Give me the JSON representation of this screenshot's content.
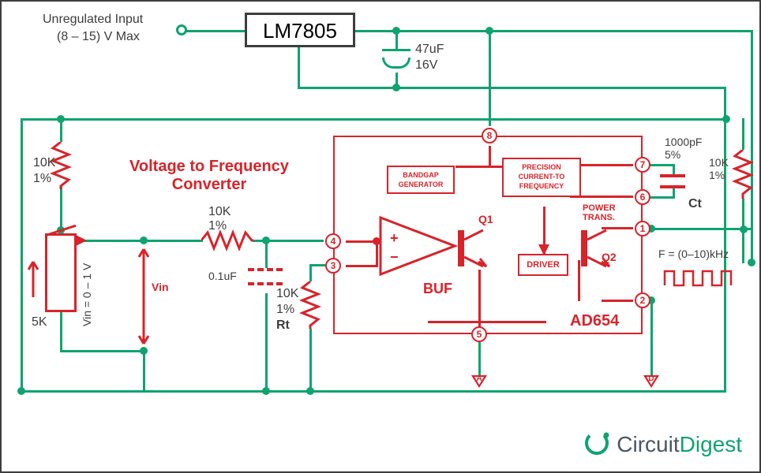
{
  "input": {
    "label_line1": "Unregulated Input",
    "label_line2": "(8 – 15) V Max"
  },
  "regulator": {
    "name": "LM7805"
  },
  "c1": {
    "value": "47uF",
    "voltage": "16V"
  },
  "c2": {
    "value": "0.1uF"
  },
  "ct": {
    "value": "1000pF",
    "tolerance": "5%",
    "name": "Ct"
  },
  "r_top_left": {
    "value": "10K",
    "tolerance": "1%"
  },
  "r_series": {
    "value": "10K",
    "tolerance": "1%"
  },
  "rt": {
    "value": "10K",
    "tolerance": "1%",
    "name": "Rt"
  },
  "r_pullup": {
    "value": "10K",
    "tolerance": "1%"
  },
  "pot": {
    "value": "5K",
    "range": "Vin = 0 – 1 V",
    "tap_label": "Vin"
  },
  "title": "Voltage to Frequency\nConverter",
  "ic": {
    "name": "AD654",
    "pins": {
      "p1": "1",
      "p2": "2",
      "p3": "3",
      "p4": "4",
      "p5": "5",
      "p6": "6",
      "p7": "7",
      "p8": "8"
    },
    "blocks": {
      "bandgap": "BANDGAP\nGENERATOR",
      "precision": "PRECISION\nCURRENT-TO\nFREQUENCY",
      "driver": "DRIVER",
      "power_trans": "POWER\nTRANS.",
      "buf": "BUF",
      "q1": "Q1",
      "q2": "Q2"
    }
  },
  "output": {
    "label": "F = (0–10)kHz"
  },
  "gnd": {
    "analog": "A",
    "digital": "D"
  },
  "logo": {
    "part1": "Circuit",
    "part2": "Digest"
  }
}
